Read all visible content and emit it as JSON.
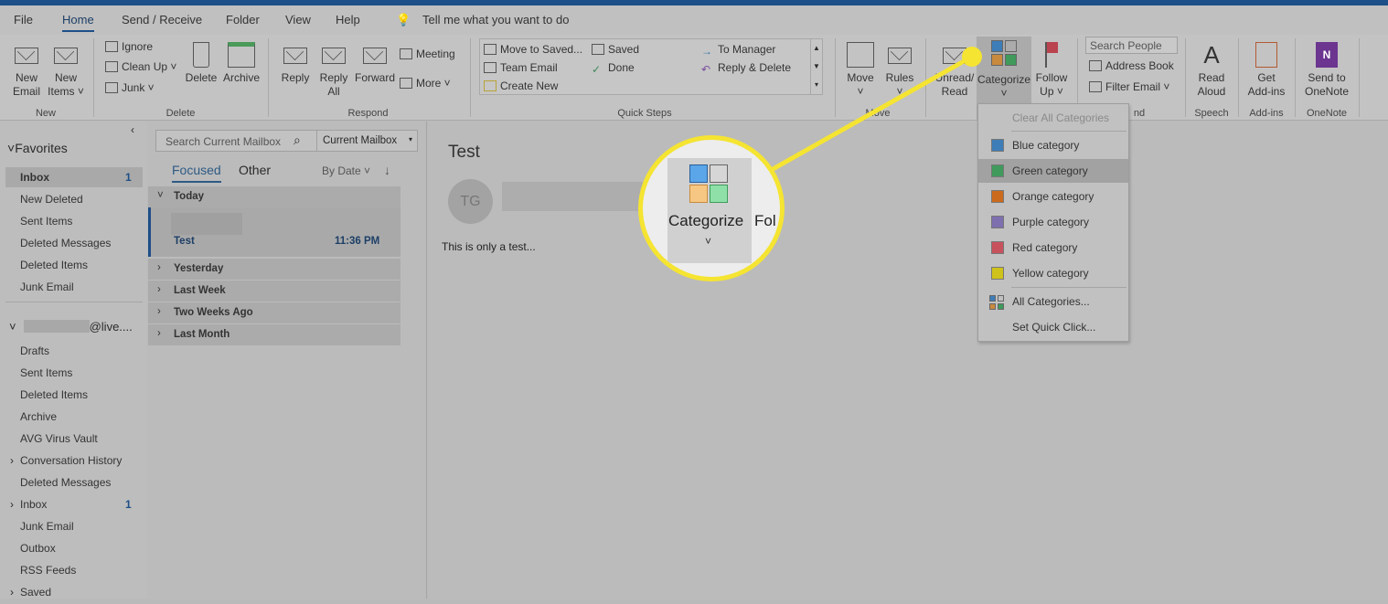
{
  "tabs": [
    "File",
    "Home",
    "Send / Receive",
    "Folder",
    "View",
    "Help"
  ],
  "tell_me": "Tell me what you want to do",
  "ribbon": {
    "new": {
      "label": "New",
      "new_email": [
        "New",
        "Email"
      ],
      "new_items": [
        "New",
        "Items ˅"
      ]
    },
    "delete": {
      "label": "Delete",
      "ignore": "Ignore",
      "clean_up": "Clean Up ˅",
      "junk": "Junk ˅",
      "delete": "Delete",
      "archive": "Archive"
    },
    "respond": {
      "label": "Respond",
      "reply": "Reply",
      "reply_all": [
        "Reply",
        "All"
      ],
      "forward": "Forward",
      "meeting": "Meeting",
      "more": "More ˅"
    },
    "quick_steps": {
      "label": "Quick Steps",
      "items": [
        "Move to Saved...",
        "Team Email",
        "Create New",
        "Saved",
        "Done",
        "To Manager",
        "Reply & Delete"
      ]
    },
    "move": {
      "label": "Move",
      "move": "Move",
      "rules": "Rules"
    },
    "tags": {
      "unread": [
        "Unread/",
        "Read"
      ],
      "categorize": "Categorize",
      "follow_up": [
        "Follow",
        "Up ˅"
      ]
    },
    "find": {
      "label": "nd",
      "search_people": "Search People",
      "address_book": "Address Book",
      "filter_email": "Filter Email ˅"
    },
    "speech": {
      "label": "Speech",
      "read_aloud": [
        "Read",
        "Aloud"
      ]
    },
    "addins": {
      "label": "Add-ins",
      "get": [
        "Get",
        "Add-ins"
      ]
    },
    "onenote": {
      "label": "OneNote",
      "send": [
        "Send to",
        "OneNote"
      ]
    }
  },
  "folders": {
    "favorites_label": "Favorites",
    "favorites": [
      {
        "name": "Inbox",
        "count": "1"
      },
      {
        "name": "New Deleted"
      },
      {
        "name": "Sent Items"
      },
      {
        "name": "Deleted Messages"
      },
      {
        "name": "Deleted Items"
      },
      {
        "name": "Junk Email"
      }
    ],
    "account": "@live....",
    "account_items": [
      {
        "name": "Drafts"
      },
      {
        "name": "Sent Items"
      },
      {
        "name": "Deleted Items"
      },
      {
        "name": "Archive"
      },
      {
        "name": "AVG Virus Vault"
      },
      {
        "name": "Conversation History",
        "expand": true
      },
      {
        "name": "Deleted Messages"
      },
      {
        "name": "Inbox",
        "count": "1",
        "expand": true
      },
      {
        "name": "Junk Email"
      },
      {
        "name": "Outbox"
      },
      {
        "name": "RSS Feeds"
      },
      {
        "name": "Saved",
        "expand": true
      }
    ]
  },
  "list": {
    "search_placeholder": "Search Current Mailbox",
    "scope": "Current Mailbox",
    "focused": "Focused",
    "other": "Other",
    "sort": "By Date ˅",
    "sort_dir": "↓",
    "groups": [
      "Today",
      "Yesterday",
      "Last Week",
      "Two Weeks Ago",
      "Last Month"
    ],
    "message": {
      "subject": "Test",
      "time": "11:36 PM"
    }
  },
  "reading": {
    "subject": "Test",
    "initials": "TG",
    "body": "This is only a test..."
  },
  "callout": {
    "label": "Categorize",
    "color": "#f5e431"
  },
  "menu": {
    "clear": "Clear All Categories",
    "categories": [
      {
        "name": "Blue category",
        "color": "#3d7db8"
      },
      {
        "name": "Green category",
        "color": "#3f9a5c"
      },
      {
        "name": "Orange category",
        "color": "#cc6a1c"
      },
      {
        "name": "Purple category",
        "color": "#7e6fae"
      },
      {
        "name": "Red category",
        "color": "#c7525e"
      },
      {
        "name": "Yellow category",
        "color": "#cfc21a"
      }
    ],
    "all": "All Categories...",
    "quick": "Set Quick Click..."
  }
}
